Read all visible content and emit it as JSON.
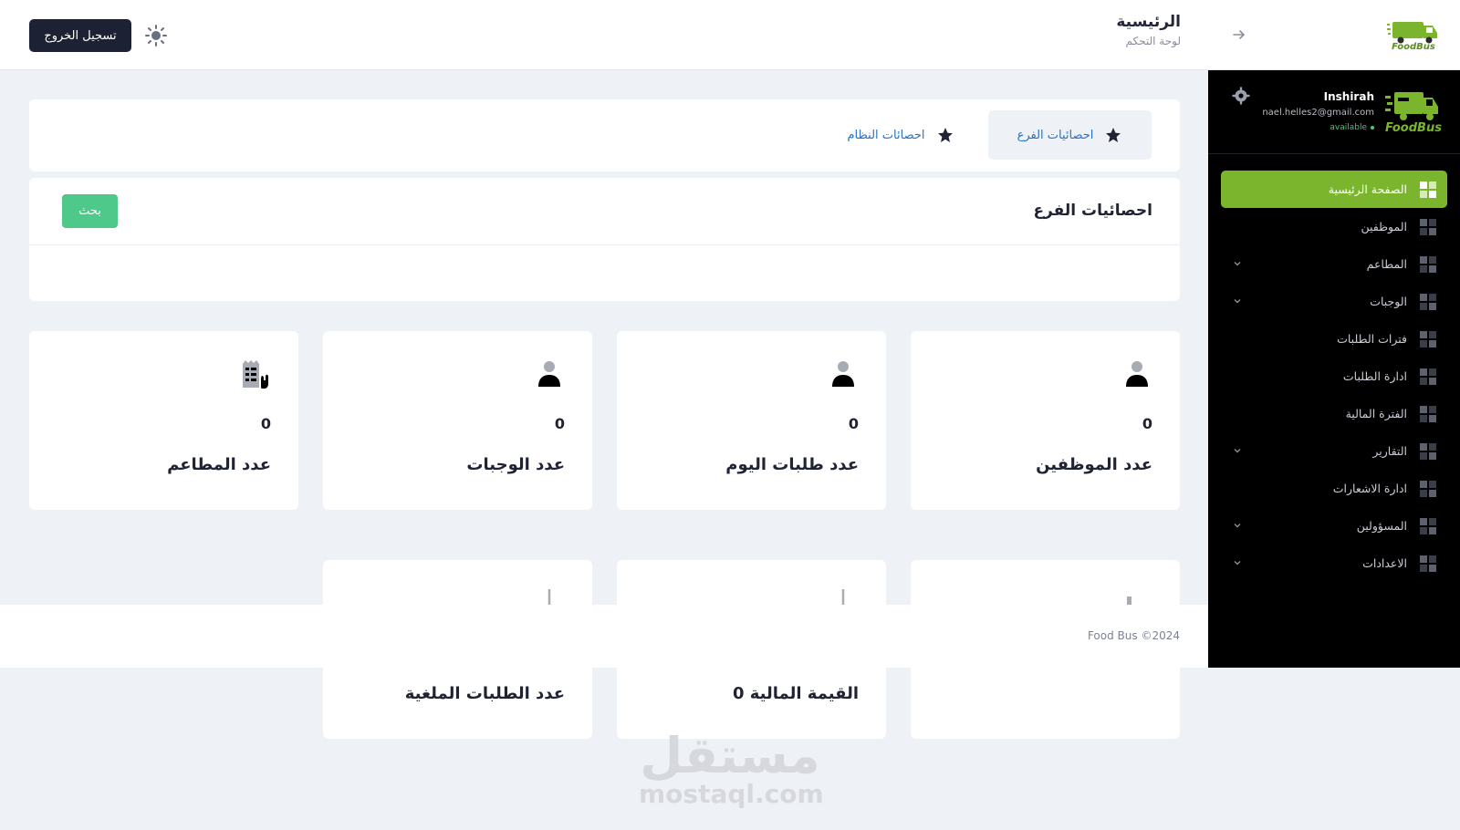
{
  "header": {
    "title": "الرئيسية",
    "subtitle": "لوحة التحكم",
    "logout_label": "تسجيل الخروج",
    "logo_text": "FoodBus"
  },
  "sidebar": {
    "profile": {
      "name": "Inshirah",
      "email": "nael.helles2@gmail.com",
      "status": "available",
      "logo_text": "FoodBus"
    },
    "items": [
      {
        "label": "الصفحة الرئيسية",
        "active": true,
        "has_children": false
      },
      {
        "label": "الموظفين",
        "active": false,
        "has_children": false
      },
      {
        "label": "المطاعم",
        "active": false,
        "has_children": true
      },
      {
        "label": "الوجبات",
        "active": false,
        "has_children": true
      },
      {
        "label": "فترات الطلبات",
        "active": false,
        "has_children": false
      },
      {
        "label": "ادارة الطلبات",
        "active": false,
        "has_children": false
      },
      {
        "label": "الفترة المالية",
        "active": false,
        "has_children": false
      },
      {
        "label": "التقارير",
        "active": false,
        "has_children": true
      },
      {
        "label": "ادارة الاشعارات",
        "active": false,
        "has_children": false
      },
      {
        "label": "المسؤولين",
        "active": false,
        "has_children": true
      },
      {
        "label": "الاعدادات",
        "active": false,
        "has_children": true
      }
    ]
  },
  "tabs": [
    {
      "label": "احصائيات الفرع",
      "active": true,
      "icon": "star-icon"
    },
    {
      "label": "احصائات النظام",
      "active": false,
      "icon": "star-icon"
    }
  ],
  "search": {
    "title": "احصائيات الفرع",
    "button_label": "بحث"
  },
  "stats": [
    {
      "label": "عدد الموظفين",
      "value": "0",
      "icon": "user-icon"
    },
    {
      "label": "عدد طلبات اليوم",
      "value": "0",
      "icon": "user-icon"
    },
    {
      "label": "عدد الوجبات",
      "value": "0",
      "icon": "user-icon"
    },
    {
      "label": "عدد المطاعم",
      "value": "0",
      "icon": "building-icon"
    },
    {
      "label": "",
      "value": "",
      "icon": "chart-icon"
    },
    {
      "label": "القيمة المالية 0",
      "value": "",
      "icon": "download-icon"
    },
    {
      "label": "عدد الطلبات الملغية",
      "value": "",
      "icon": "download-icon"
    }
  ],
  "footer": {
    "text": "Food Bus ©2024"
  },
  "watermark": {
    "ar": "مستقل",
    "en": "mostaql.com"
  },
  "colors": {
    "accent": "#7bb52d",
    "sidebar_bg": "#000000",
    "search_button": "#4fc98a",
    "logout_button": "#1c2233",
    "tab_text": "#2a73c4"
  }
}
